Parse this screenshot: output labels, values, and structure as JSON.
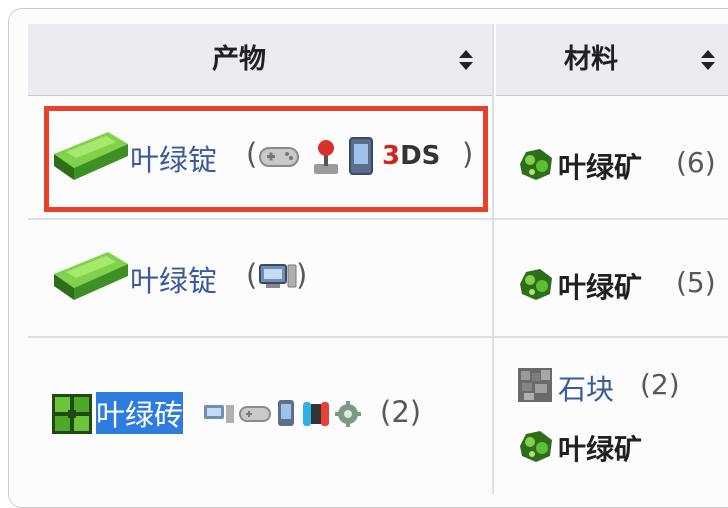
{
  "table": {
    "headers": [
      {
        "label": "产物"
      },
      {
        "label": "材料"
      }
    ],
    "rows": [
      {
        "product": "叶绿锭",
        "open_paren": "(",
        "close_paren": ")",
        "platform_text": "3DS",
        "materials": [
          {
            "name": "叶绿矿",
            "count": "(6)"
          }
        ]
      },
      {
        "product": "叶绿锭",
        "open_paren": "(",
        "close_paren": ")",
        "materials": [
          {
            "name": "叶绿矿",
            "count": "(5)"
          }
        ]
      },
      {
        "product": "叶绿砖",
        "count": "(2)",
        "materials": [
          {
            "name": "石块",
            "count": "(2)"
          },
          {
            "name": "叶绿矿",
            "count": ""
          }
        ]
      }
    ]
  },
  "colors": {
    "accent_red": "#e8402a",
    "selection_blue": "#2f7ce0",
    "link_blue": "#3a5a9b"
  }
}
